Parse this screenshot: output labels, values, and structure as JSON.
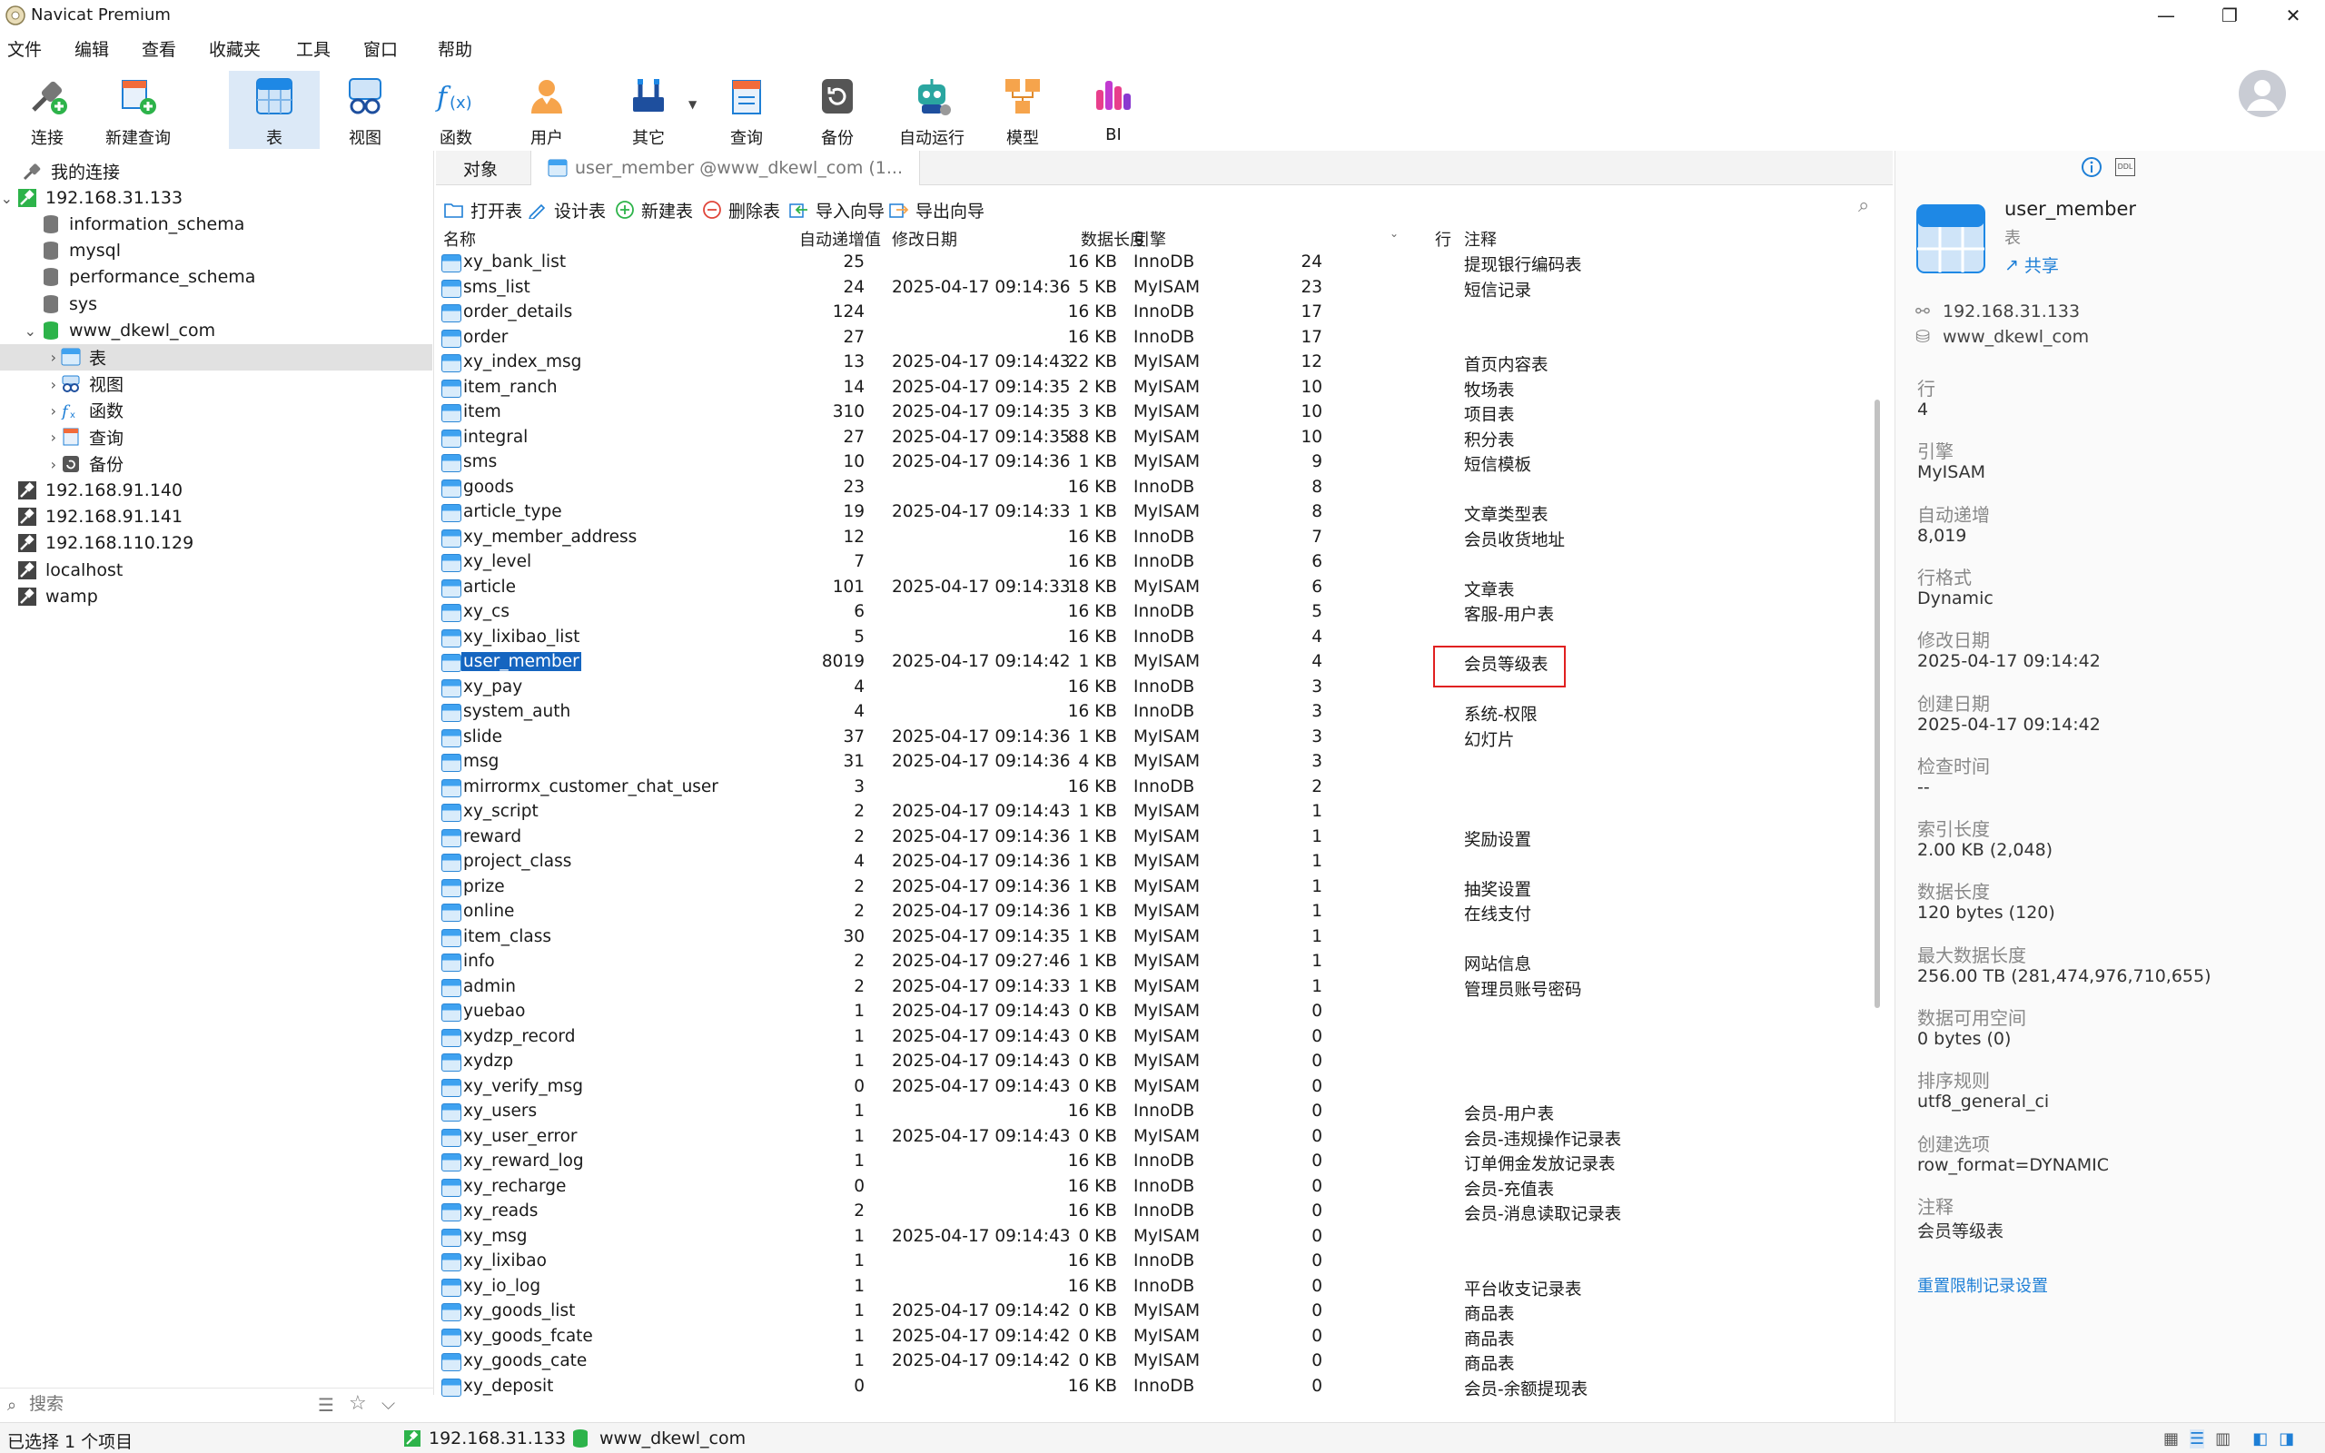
{
  "window": {
    "title": "Navicat Premium",
    "minimize": "—",
    "maximize": "❐",
    "close": "✕"
  },
  "menu": [
    "文件",
    "编辑",
    "查看",
    "收藏夹",
    "工具",
    "窗口",
    "帮助"
  ],
  "toolbar": [
    {
      "label": "连接",
      "icon": "connect-icon"
    },
    {
      "label": "新建查询",
      "icon": "new-query-icon"
    },
    {
      "label": "表",
      "icon": "table-icon",
      "active": true
    },
    {
      "label": "视图",
      "icon": "view-icon"
    },
    {
      "label": "函数",
      "icon": "function-icon"
    },
    {
      "label": "用户",
      "icon": "user-icon"
    },
    {
      "label": "其它",
      "icon": "tools-icon"
    },
    {
      "label": "查询",
      "icon": "query-icon"
    },
    {
      "label": "备份",
      "icon": "backup-icon"
    },
    {
      "label": "自动运行",
      "icon": "robot-icon"
    },
    {
      "label": "模型",
      "icon": "model-icon"
    },
    {
      "label": "BI",
      "icon": "bi-icon"
    }
  ],
  "tree": {
    "root": "我的连接",
    "items": [
      {
        "label": "192.168.31.133",
        "level": 1,
        "expanded": true,
        "type": "conn-on"
      },
      {
        "label": "information_schema",
        "level": 2,
        "type": "db"
      },
      {
        "label": "mysql",
        "level": 2,
        "type": "db"
      },
      {
        "label": "performance_schema",
        "level": 2,
        "type": "db"
      },
      {
        "label": "sys",
        "level": 2,
        "type": "db"
      },
      {
        "label": "www_dkewl_com",
        "level": 2,
        "expanded": true,
        "type": "db-open"
      },
      {
        "label": "表",
        "level": 3,
        "type": "tables",
        "selected": true
      },
      {
        "label": "视图",
        "level": 3,
        "type": "views"
      },
      {
        "label": "函数",
        "level": 3,
        "type": "funcs"
      },
      {
        "label": "查询",
        "level": 3,
        "type": "queries"
      },
      {
        "label": "备份",
        "level": 3,
        "type": "backups"
      },
      {
        "label": "192.168.91.140",
        "level": 1,
        "type": "conn-off"
      },
      {
        "label": "192.168.91.141",
        "level": 1,
        "type": "conn-off"
      },
      {
        "label": "192.168.110.129",
        "level": 1,
        "type": "conn-off"
      },
      {
        "label": "localhost",
        "level": 1,
        "type": "conn-off"
      },
      {
        "label": "wamp",
        "level": 1,
        "type": "conn-off"
      }
    ]
  },
  "search": {
    "placeholder": "搜索"
  },
  "tabs": {
    "objects": "对象",
    "active_tab": "user_member @www_dkewl_com (1..."
  },
  "obj_toolbar": [
    "打开表",
    "设计表",
    "新建表",
    "删除表",
    "导入向导",
    "导出向导"
  ],
  "columns": {
    "name": "名称",
    "auto_inc": "自动递增值",
    "modified": "修改日期",
    "data_len": "数据长度",
    "engine": "引擎",
    "rows": "行",
    "comment": "注释"
  },
  "rows": [
    [
      "xy_bank_list",
      "25",
      "",
      "16 KB",
      "InnoDB",
      "24",
      "提现银行编码表"
    ],
    [
      "sms_list",
      "24",
      "2025-04-17 09:14:36",
      "5 KB",
      "MyISAM",
      "23",
      "短信记录"
    ],
    [
      "order_details",
      "124",
      "",
      "16 KB",
      "InnoDB",
      "17",
      ""
    ],
    [
      "order",
      "27",
      "",
      "16 KB",
      "InnoDB",
      "17",
      ""
    ],
    [
      "xy_index_msg",
      "13",
      "2025-04-17 09:14:43",
      "22 KB",
      "MyISAM",
      "12",
      "首页内容表"
    ],
    [
      "item_ranch",
      "14",
      "2025-04-17 09:14:35",
      "2 KB",
      "MyISAM",
      "10",
      "牧场表"
    ],
    [
      "item",
      "310",
      "2025-04-17 09:14:35",
      "3 KB",
      "MyISAM",
      "10",
      "项目表"
    ],
    [
      "integral",
      "27",
      "2025-04-17 09:14:35",
      "88 KB",
      "MyISAM",
      "10",
      "积分表"
    ],
    [
      "sms",
      "10",
      "2025-04-17 09:14:36",
      "1 KB",
      "MyISAM",
      "9",
      "短信模板"
    ],
    [
      "goods",
      "23",
      "",
      "16 KB",
      "InnoDB",
      "8",
      ""
    ],
    [
      "article_type",
      "19",
      "2025-04-17 09:14:33",
      "1 KB",
      "MyISAM",
      "8",
      "文章类型表"
    ],
    [
      "xy_member_address",
      "12",
      "",
      "16 KB",
      "InnoDB",
      "7",
      "会员收货地址"
    ],
    [
      "xy_level",
      "7",
      "",
      "16 KB",
      "InnoDB",
      "6",
      ""
    ],
    [
      "article",
      "101",
      "2025-04-17 09:14:33",
      "18 KB",
      "MyISAM",
      "6",
      "文章表"
    ],
    [
      "xy_cs",
      "6",
      "",
      "16 KB",
      "InnoDB",
      "5",
      "客服-用户表"
    ],
    [
      "xy_lixibao_list",
      "5",
      "",
      "16 KB",
      "InnoDB",
      "4",
      ""
    ],
    [
      "user_member",
      "8019",
      "2025-04-17 09:14:42",
      "1 KB",
      "MyISAM",
      "4",
      "会员等级表"
    ],
    [
      "xy_pay",
      "4",
      "",
      "16 KB",
      "InnoDB",
      "3",
      ""
    ],
    [
      "system_auth",
      "4",
      "",
      "16 KB",
      "InnoDB",
      "3",
      "系统-权限"
    ],
    [
      "slide",
      "37",
      "2025-04-17 09:14:36",
      "1 KB",
      "MyISAM",
      "3",
      "幻灯片"
    ],
    [
      "msg",
      "31",
      "2025-04-17 09:14:36",
      "4 KB",
      "MyISAM",
      "3",
      ""
    ],
    [
      "mirrormx_customer_chat_user",
      "3",
      "",
      "16 KB",
      "InnoDB",
      "2",
      ""
    ],
    [
      "xy_script",
      "2",
      "2025-04-17 09:14:43",
      "1 KB",
      "MyISAM",
      "1",
      ""
    ],
    [
      "reward",
      "2",
      "2025-04-17 09:14:36",
      "1 KB",
      "MyISAM",
      "1",
      "奖励设置"
    ],
    [
      "project_class",
      "4",
      "2025-04-17 09:14:36",
      "1 KB",
      "MyISAM",
      "1",
      ""
    ],
    [
      "prize",
      "2",
      "2025-04-17 09:14:36",
      "1 KB",
      "MyISAM",
      "1",
      "抽奖设置"
    ],
    [
      "online",
      "2",
      "2025-04-17 09:14:36",
      "1 KB",
      "MyISAM",
      "1",
      "在线支付"
    ],
    [
      "item_class",
      "30",
      "2025-04-17 09:14:35",
      "1 KB",
      "MyISAM",
      "1",
      ""
    ],
    [
      "info",
      "2",
      "2025-04-17 09:27:46",
      "1 KB",
      "MyISAM",
      "1",
      "网站信息"
    ],
    [
      "admin",
      "2",
      "2025-04-17 09:14:33",
      "1 KB",
      "MyISAM",
      "1",
      "管理员账号密码"
    ],
    [
      "yuebao",
      "1",
      "2025-04-17 09:14:43",
      "0 KB",
      "MyISAM",
      "0",
      ""
    ],
    [
      "xydzp_record",
      "1",
      "2025-04-17 09:14:43",
      "0 KB",
      "MyISAM",
      "0",
      ""
    ],
    [
      "xydzp",
      "1",
      "2025-04-17 09:14:43",
      "0 KB",
      "MyISAM",
      "0",
      ""
    ],
    [
      "xy_verify_msg",
      "0",
      "2025-04-17 09:14:43",
      "0 KB",
      "MyISAM",
      "0",
      ""
    ],
    [
      "xy_users",
      "1",
      "",
      "16 KB",
      "InnoDB",
      "0",
      "会员-用户表"
    ],
    [
      "xy_user_error",
      "1",
      "2025-04-17 09:14:43",
      "0 KB",
      "MyISAM",
      "0",
      "会员-违规操作记录表"
    ],
    [
      "xy_reward_log",
      "1",
      "",
      "16 KB",
      "InnoDB",
      "0",
      "订单佣金发放记录表"
    ],
    [
      "xy_recharge",
      "0",
      "",
      "16 KB",
      "InnoDB",
      "0",
      "会员-充值表"
    ],
    [
      "xy_reads",
      "2",
      "",
      "16 KB",
      "InnoDB",
      "0",
      "会员-消息读取记录表"
    ],
    [
      "xy_msg",
      "1",
      "2025-04-17 09:14:43",
      "0 KB",
      "MyISAM",
      "0",
      ""
    ],
    [
      "xy_lixibao",
      "1",
      "",
      "16 KB",
      "InnoDB",
      "0",
      ""
    ],
    [
      "xy_io_log",
      "1",
      "",
      "16 KB",
      "InnoDB",
      "0",
      "平台收支记录表"
    ],
    [
      "xy_goods_list",
      "1",
      "2025-04-17 09:14:42",
      "0 KB",
      "MyISAM",
      "0",
      "商品表"
    ],
    [
      "xy_goods_fcate",
      "1",
      "2025-04-17 09:14:42",
      "0 KB",
      "MyISAM",
      "0",
      "商品表"
    ],
    [
      "xy_goods_cate",
      "1",
      "2025-04-17 09:14:42",
      "0 KB",
      "MyISAM",
      "0",
      "商品表"
    ],
    [
      "xy_deposit",
      "0",
      "",
      "16 KB",
      "InnoDB",
      "0",
      "会员-余额提现表"
    ]
  ],
  "selected_row": 16,
  "info": {
    "name": "user_member",
    "type": "表",
    "share": "共享",
    "host": "192.168.31.133",
    "db": "www_dkewl_com",
    "fields": [
      {
        "label": "行",
        "value": "4"
      },
      {
        "label": "引擎",
        "value": "MyISAM"
      },
      {
        "label": "自动递增",
        "value": "8,019"
      },
      {
        "label": "行格式",
        "value": "Dynamic"
      },
      {
        "label": "修改日期",
        "value": "2025-04-17 09:14:42"
      },
      {
        "label": "创建日期",
        "value": "2025-04-17 09:14:42"
      },
      {
        "label": "检查时间",
        "value": "--"
      },
      {
        "label": "索引长度",
        "value": "2.00 KB (2,048)"
      },
      {
        "label": "数据长度",
        "value": "120 bytes (120)"
      },
      {
        "label": "最大数据长度",
        "value": "256.00 TB (281,474,976,710,655)"
      },
      {
        "label": "数据可用空间",
        "value": "0 bytes (0)"
      },
      {
        "label": "排序规则",
        "value": "utf8_general_ci"
      },
      {
        "label": "创建选项",
        "value": "row_format=DYNAMIC"
      },
      {
        "label": "注释",
        "value": "会员等级表"
      }
    ],
    "reset_link": "重置限制记录设置",
    "ddl_label": "DDL"
  },
  "status": {
    "selection": "已选择 1 个项目",
    "conn": "192.168.31.133",
    "db": "www_dkewl_com"
  },
  "colors": {
    "accent": "#1e7fd6",
    "selection": "#1565c0",
    "highlight_box": "#e02020",
    "conn_on": "#2db34a"
  }
}
